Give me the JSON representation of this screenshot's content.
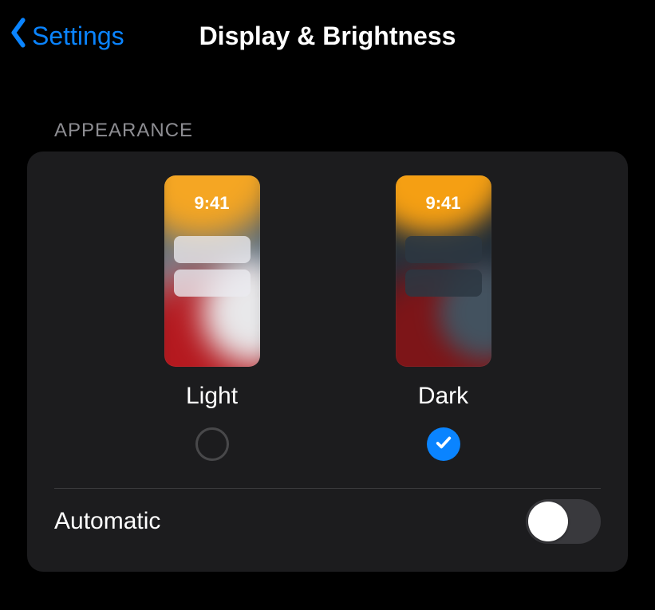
{
  "nav": {
    "back_label": "Settings",
    "title": "Display & Brightness"
  },
  "appearance": {
    "header": "APPEARANCE",
    "preview_time": "9:41",
    "options": [
      {
        "id": "light",
        "label": "Light",
        "selected": false
      },
      {
        "id": "dark",
        "label": "Dark",
        "selected": true
      }
    ]
  },
  "automatic": {
    "label": "Automatic",
    "enabled": false
  },
  "colors": {
    "accent": "#0a84ff",
    "card_bg": "#1c1c1e",
    "divider": "#3a3a3c"
  }
}
